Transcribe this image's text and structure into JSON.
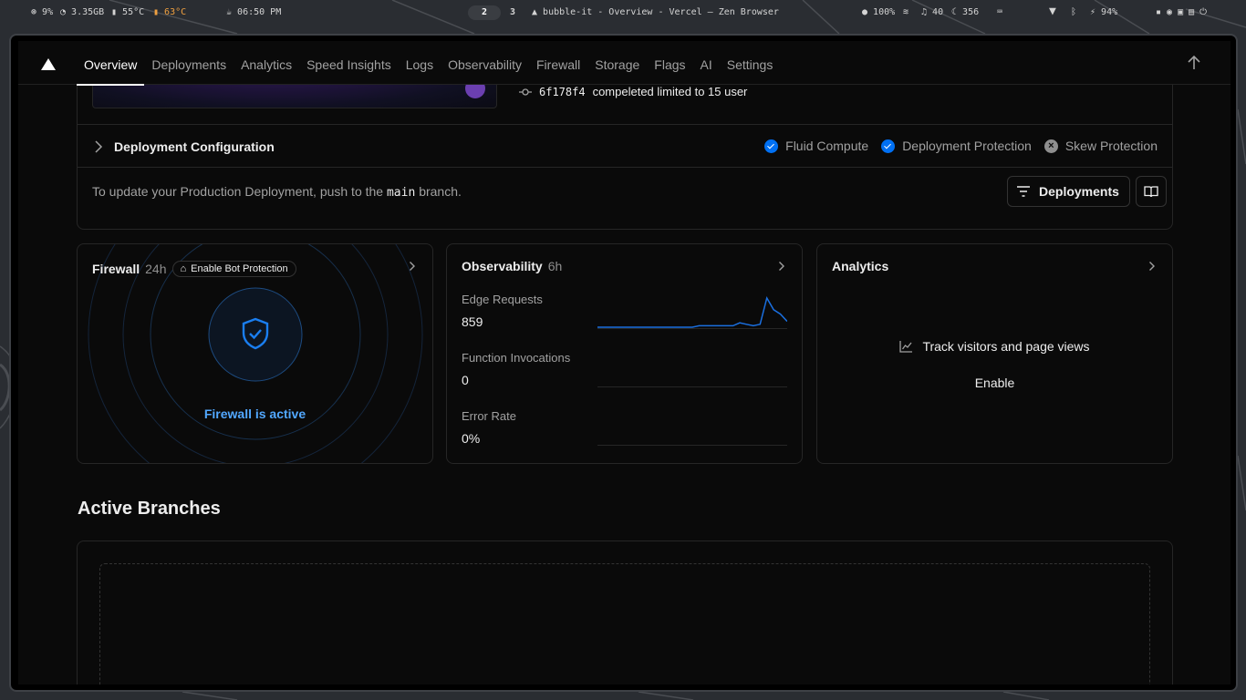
{
  "sysbar": {
    "cpu": "9%",
    "mem": "3.35GB",
    "temp1": "55°C",
    "temp2": "63°C",
    "time": "06:50 PM",
    "workspace_active": "2",
    "workspace_other": "3",
    "window_title": "bubble-it - Overview - Vercel — Zen Browser",
    "brightness": "100%",
    "volume": "40",
    "night": "356",
    "battery": "94%"
  },
  "nav": {
    "tabs": [
      "Overview",
      "Deployments",
      "Analytics",
      "Speed Insights",
      "Logs",
      "Observability",
      "Firewall",
      "Storage",
      "Flags",
      "AI",
      "Settings"
    ],
    "active_tab": "Overview"
  },
  "deployment": {
    "branch": "main",
    "commit_hash": "6f178f4",
    "commit_message": "compeleted limited to 15 user",
    "config_title": "Deployment Configuration",
    "badges": {
      "fluid": "Fluid Compute",
      "protection": "Deployment Protection",
      "skew": "Skew Protection"
    },
    "update_prefix": "To update your Production Deployment, push to the",
    "update_branch": "main",
    "update_suffix": "branch.",
    "deployments_button": "Deployments"
  },
  "firewall": {
    "title": "Firewall",
    "period": "24h",
    "badge": "Enable Bot Protection",
    "status": "Firewall is active"
  },
  "observability": {
    "title": "Observability",
    "period": "6h",
    "metrics": [
      {
        "label": "Edge Requests",
        "value": "859"
      },
      {
        "label": "Function Invocations",
        "value": "0"
      },
      {
        "label": "Error Rate",
        "value": "0%"
      }
    ],
    "edge_series": [
      0,
      0,
      0,
      0,
      0,
      0,
      0,
      0,
      0,
      0,
      0,
      0,
      0,
      0,
      0,
      0.5,
      0.5,
      0.5,
      0.5,
      0.5,
      0.5,
      1.5,
      1,
      0.5,
      1,
      10,
      6,
      4.5,
      2
    ]
  },
  "analytics": {
    "title": "Analytics",
    "track_text": "Track visitors and page views",
    "enable_label": "Enable"
  },
  "branches": {
    "title": "Active Branches"
  },
  "colors": {
    "accent_blue": "#0070f3",
    "firewall_blue": "#52a8ff",
    "chart_line": "#1a6fe0"
  }
}
